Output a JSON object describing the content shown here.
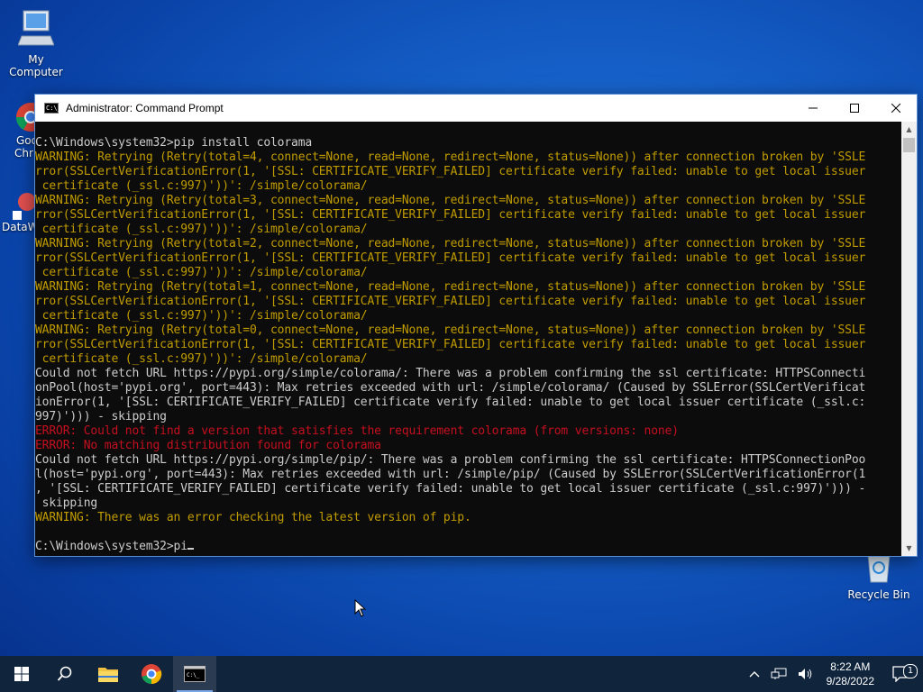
{
  "desktop": {
    "icons": [
      {
        "label": "My Computer"
      },
      {
        "label": "Goo"
      },
      {
        "label": "Chr"
      },
      {
        "label": "DataW"
      },
      {
        "label": "Recycle Bin"
      }
    ]
  },
  "window": {
    "title": "Administrator: Command Prompt",
    "icon_text": "C:\\_",
    "lines": [
      {
        "cls": "n",
        "text": "C:\\Windows\\system32>pip install colorama"
      },
      {
        "cls": "w",
        "text": "WARNING: Retrying (Retry(total=4, connect=None, read=None, redirect=None, status=None)) after connection broken by 'SSLE"
      },
      {
        "cls": "w",
        "text": "rror(SSLCertVerificationError(1, '[SSL: CERTIFICATE_VERIFY_FAILED] certificate verify failed: unable to get local issuer"
      },
      {
        "cls": "w",
        "text": " certificate (_ssl.c:997)'))': /simple/colorama/"
      },
      {
        "cls": "w",
        "text": "WARNING: Retrying (Retry(total=3, connect=None, read=None, redirect=None, status=None)) after connection broken by 'SSLE"
      },
      {
        "cls": "w",
        "text": "rror(SSLCertVerificationError(1, '[SSL: CERTIFICATE_VERIFY_FAILED] certificate verify failed: unable to get local issuer"
      },
      {
        "cls": "w",
        "text": " certificate (_ssl.c:997)'))': /simple/colorama/"
      },
      {
        "cls": "w",
        "text": "WARNING: Retrying (Retry(total=2, connect=None, read=None, redirect=None, status=None)) after connection broken by 'SSLE"
      },
      {
        "cls": "w",
        "text": "rror(SSLCertVerificationError(1, '[SSL: CERTIFICATE_VERIFY_FAILED] certificate verify failed: unable to get local issuer"
      },
      {
        "cls": "w",
        "text": " certificate (_ssl.c:997)'))': /simple/colorama/"
      },
      {
        "cls": "w",
        "text": "WARNING: Retrying (Retry(total=1, connect=None, read=None, redirect=None, status=None)) after connection broken by 'SSLE"
      },
      {
        "cls": "w",
        "text": "rror(SSLCertVerificationError(1, '[SSL: CERTIFICATE_VERIFY_FAILED] certificate verify failed: unable to get local issuer"
      },
      {
        "cls": "w",
        "text": " certificate (_ssl.c:997)'))': /simple/colorama/"
      },
      {
        "cls": "w",
        "text": "WARNING: Retrying (Retry(total=0, connect=None, read=None, redirect=None, status=None)) after connection broken by 'SSLE"
      },
      {
        "cls": "w",
        "text": "rror(SSLCertVerificationError(1, '[SSL: CERTIFICATE_VERIFY_FAILED] certificate verify failed: unable to get local issuer"
      },
      {
        "cls": "w",
        "text": " certificate (_ssl.c:997)'))': /simple/colorama/"
      },
      {
        "cls": "n",
        "text": "Could not fetch URL https://pypi.org/simple/colorama/: There was a problem confirming the ssl certificate: HTTPSConnecti"
      },
      {
        "cls": "n",
        "text": "onPool(host='pypi.org', port=443): Max retries exceeded with url: /simple/colorama/ (Caused by SSLError(SSLCertVerificat"
      },
      {
        "cls": "n",
        "text": "ionError(1, '[SSL: CERTIFICATE_VERIFY_FAILED] certificate verify failed: unable to get local issuer certificate (_ssl.c:"
      },
      {
        "cls": "n",
        "text": "997)'))) - skipping"
      },
      {
        "cls": "e",
        "text": "ERROR: Could not find a version that satisfies the requirement colorama (from versions: none)"
      },
      {
        "cls": "e",
        "text": "ERROR: No matching distribution found for colorama"
      },
      {
        "cls": "n",
        "text": "Could not fetch URL https://pypi.org/simple/pip/: There was a problem confirming the ssl certificate: HTTPSConnectionPoo"
      },
      {
        "cls": "n",
        "text": "l(host='pypi.org', port=443): Max retries exceeded with url: /simple/pip/ (Caused by SSLError(SSLCertVerificationError(1"
      },
      {
        "cls": "n",
        "text": ", '[SSL: CERTIFICATE_VERIFY_FAILED] certificate verify failed: unable to get local issuer certificate (_ssl.c:997)'))) -"
      },
      {
        "cls": "n",
        "text": " skipping"
      },
      {
        "cls": "w",
        "text": "WARNING: There was an error checking the latest version of pip."
      },
      {
        "cls": "n",
        "text": ""
      }
    ],
    "prompt": "C:\\Windows\\system32>pi"
  },
  "taskbar": {
    "clock_time": "8:22 AM",
    "clock_date": "9/28/2022",
    "notification_count": "1"
  },
  "colors": {
    "warning": "#c19c00",
    "error": "#c50f1f",
    "console_text": "#cccccc",
    "console_bg": "#0c0c0c",
    "taskbar_bg": "#10243c"
  }
}
